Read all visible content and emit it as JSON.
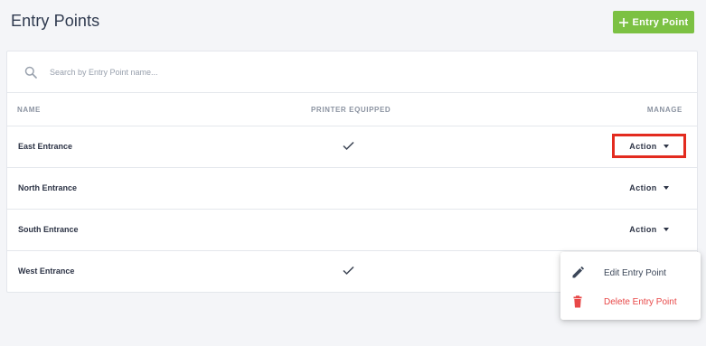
{
  "header": {
    "title": "Entry Points",
    "add_button_label": "Entry Point"
  },
  "search": {
    "placeholder": "Search by Entry Point name...",
    "value": ""
  },
  "table": {
    "columns": {
      "name": "NAME",
      "printer": "PRINTER EQUIPPED",
      "manage": "MANAGE"
    },
    "rows": [
      {
        "name": "East Entrance",
        "printer_equipped": true,
        "action_label": "Action"
      },
      {
        "name": "North Entrance",
        "printer_equipped": false,
        "action_label": "Action"
      },
      {
        "name": "South Entrance",
        "printer_equipped": false,
        "action_label": "Action"
      },
      {
        "name": "West Entrance",
        "printer_equipped": true,
        "action_label": "Action"
      }
    ]
  },
  "action_menu": {
    "items": [
      {
        "label": "Edit Entry Point",
        "icon": "pencil-icon"
      },
      {
        "label": "Delete Entry Point",
        "icon": "trash-icon"
      }
    ]
  },
  "colors": {
    "accent_green": "#7cc143",
    "danger_red": "#e84848",
    "highlight_red": "#e32b1f",
    "text_dark": "#2c3345",
    "text_muted": "#8b93a1"
  }
}
